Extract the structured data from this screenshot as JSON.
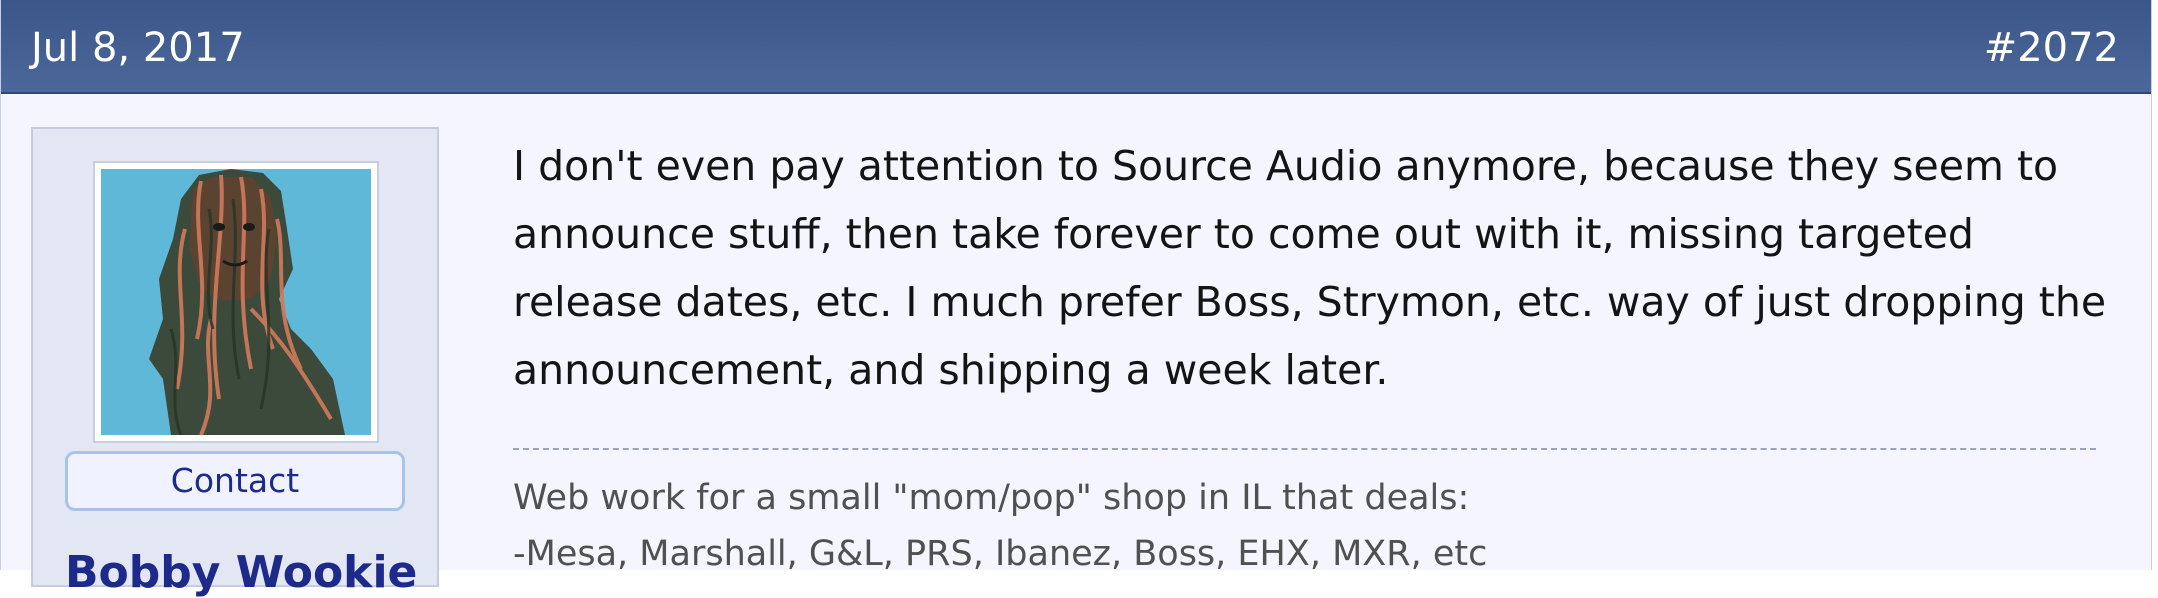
{
  "post": {
    "date": "Jul 8, 2017",
    "number": "#2072",
    "message": "I don't even pay attention to Source Audio anymore, because they seem to announce stuff, then take forever to come out with it, missing targeted release dates, etc. I much prefer Boss, Strymon, etc. way of just dropping the announcement, and shipping a week later.",
    "signature": {
      "lines": [
        "Web work for a small \"mom/pop\" shop in IL that deals:",
        "-Mesa, Marshall, G&L, PRS, Ibanez, Boss, EHX, MXR, etc"
      ]
    }
  },
  "author": {
    "contact_label": "Contact",
    "username": "Bobby Wookie"
  },
  "colors": {
    "header": "#3b5689",
    "post_background": "#f5f5ff",
    "sidebar": "#e3e6f3",
    "link": "#1d2a8a"
  },
  "icons": {
    "avatar": "wookiee-avatar"
  }
}
